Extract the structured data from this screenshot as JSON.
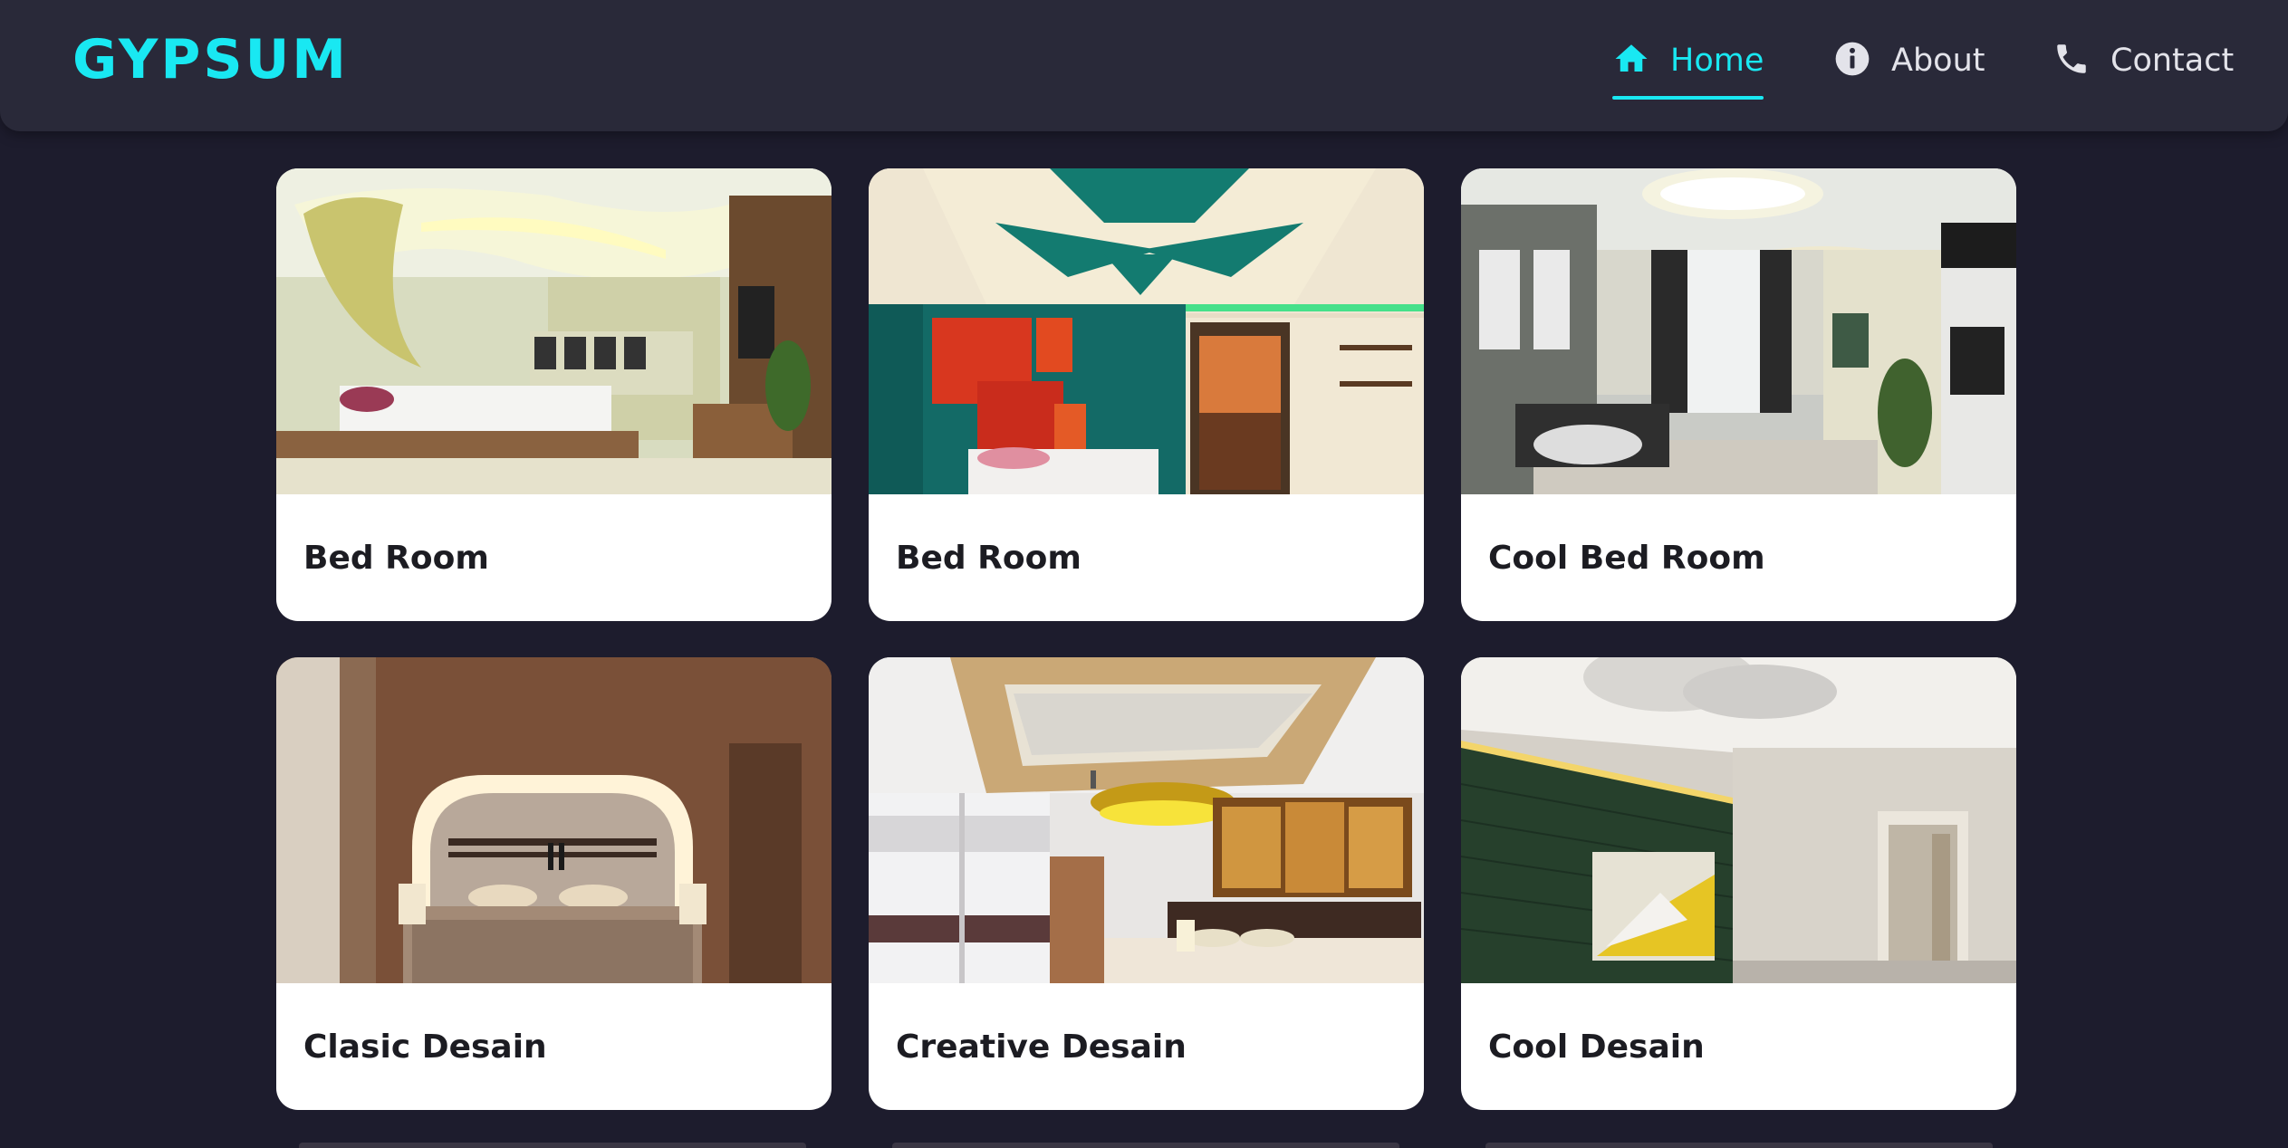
{
  "brand": "GYPSUM",
  "nav": {
    "home": "Home",
    "about": "About",
    "contact": "Contact"
  },
  "colors": {
    "accent": "#19e8f2",
    "background": "#1d1c2d",
    "navbar": "#292939",
    "card": "#ffffff"
  },
  "icons": {
    "home": "home-icon",
    "about": "info-icon",
    "contact": "phone-icon"
  },
  "cards": [
    {
      "title": "Bed Room"
    },
    {
      "title": "Bed Room"
    },
    {
      "title": "Cool Bed Room"
    },
    {
      "title": "Clasic Desain"
    },
    {
      "title": "Creative Desain"
    },
    {
      "title": "Cool Desain"
    }
  ]
}
